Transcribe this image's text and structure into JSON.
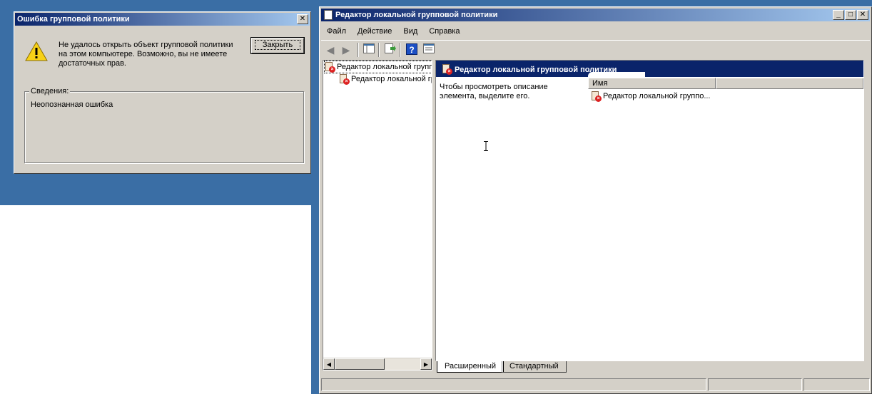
{
  "error_dialog": {
    "title": "Ошибка групповой политики",
    "message_line1": "Не удалось открыть объект групповой политики",
    "message_line2": "на этом компьютере. Возможно, вы не имеете",
    "message_line3": "достаточных прав.",
    "close_label": "Закрыть",
    "details_label": "Сведения:",
    "details_text": "Неопознанная ошибка",
    "close_x": "✕",
    "icon": "warning-icon"
  },
  "mmc": {
    "title": "Редактор локальной групповой политики",
    "window_buttons": {
      "minimize": "_",
      "maximize": "□",
      "close": "✕"
    },
    "menu": [
      "Файл",
      "Действие",
      "Вид",
      "Справка"
    ],
    "tree": {
      "root": "Редактор локальной групповой политики",
      "child": "Редактор локальной групповой политики"
    },
    "content": {
      "header": "Редактор локальной групповой политики",
      "description_line1": "Чтобы просмотреть описание",
      "description_line2": "элемента, выделите его.",
      "column_name": "Имя",
      "item": "Редактор локальной группо..."
    },
    "tabs": {
      "extended": "Расширенный",
      "standard": "Стандартный"
    }
  },
  "colors": {
    "desktop": "#3a6ea5",
    "titlebar_start": "#0a246a",
    "titlebar_end": "#a6caf0",
    "face": "#d4d0c8"
  }
}
